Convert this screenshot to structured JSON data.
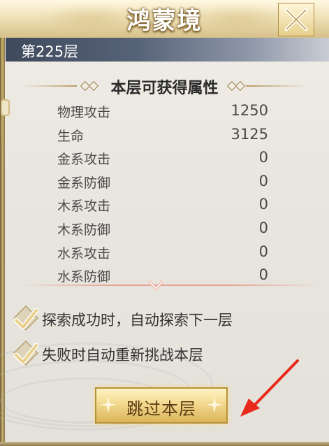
{
  "window": {
    "title": "鸿蒙境"
  },
  "level": {
    "label": "第225层"
  },
  "attributes": {
    "section_title": "本层可获得属性",
    "rows": [
      {
        "name": "物理攻击",
        "value": "1250"
      },
      {
        "name": "生命",
        "value": "3125"
      },
      {
        "name": "金系攻击",
        "value": "0"
      },
      {
        "name": "金系防御",
        "value": "0"
      },
      {
        "name": "木系攻击",
        "value": "0"
      },
      {
        "name": "木系防御",
        "value": "0"
      },
      {
        "name": "水系攻击",
        "value": "0"
      },
      {
        "name": "水系防御",
        "value": "0"
      }
    ]
  },
  "options": {
    "auto_next": {
      "label": "探索成功时，自动探索下一层",
      "checked": true
    },
    "auto_retry": {
      "label": "失败时自动重新挑战本层",
      "checked": true
    }
  },
  "actions": {
    "skip_label": "跳过本层"
  },
  "colors": {
    "accent_gold": "#dcb45a",
    "check_gold": "#e9cf8a",
    "arrow_red": "#e8291c"
  },
  "icons": {
    "close": "close-x-icon",
    "checkbox": "checkmark-icon",
    "annotation": "red-arrow-icon"
  }
}
